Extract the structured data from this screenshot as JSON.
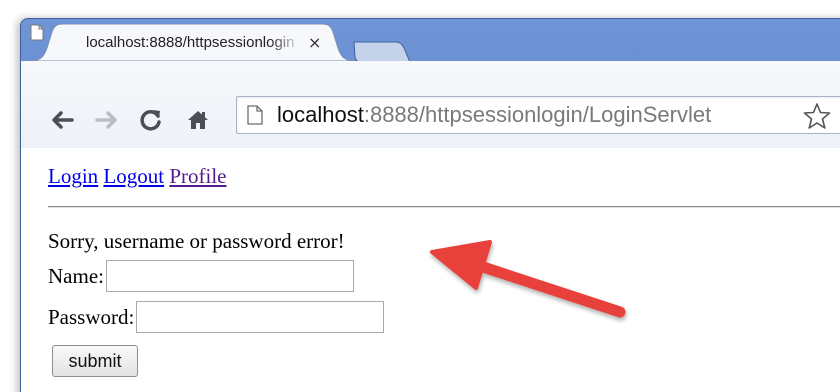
{
  "browser": {
    "tab_title": "localhost:8888/httpsessionlogin",
    "tab_close_glyph": "×",
    "url_host": "localhost",
    "url_rest": ":8888/httpsessionlogin/LoginServlet",
    "icons": {
      "back": "back-arrow-icon",
      "forward": "forward-arrow-icon",
      "reload": "reload-icon",
      "home": "home-icon",
      "page": "page-icon",
      "bookmark": "star-icon"
    },
    "colors": {
      "frame": "#5a82c9",
      "toolbar": "#eef2f7"
    }
  },
  "page": {
    "nav": {
      "login": "Login",
      "logout": "Logout",
      "profile": "Profile"
    },
    "error_message": "Sorry, username or password error!",
    "form": {
      "name_label": "Name:",
      "name_value": "",
      "password_label": "Password:",
      "password_value": "",
      "submit_label": "submit"
    },
    "colors": {
      "link": "#0000ee",
      "visited_link": "#551a8b",
      "annotation_arrow": "#e8413b"
    }
  }
}
